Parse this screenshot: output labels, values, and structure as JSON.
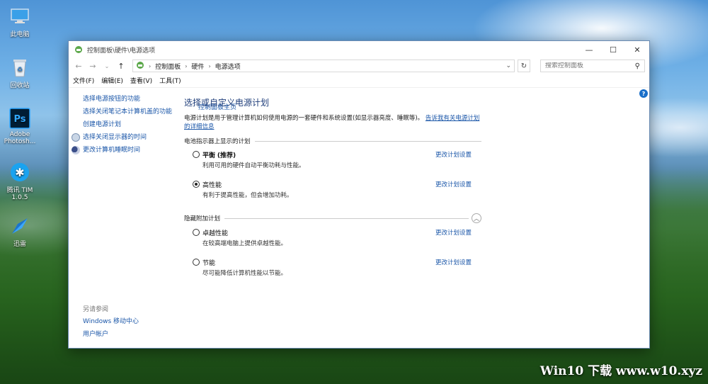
{
  "desktop": {
    "icons": [
      {
        "label": "此电脑"
      },
      {
        "label": "回收站"
      },
      {
        "label": "Adobe Photosh..."
      },
      {
        "label": "腾讯 TIM 1.0.5"
      },
      {
        "label": "迅雷"
      }
    ],
    "watermark": "Win10 下载 www.w10.xyz"
  },
  "window": {
    "title": "控制面板\\硬件\\电源选项",
    "address": {
      "crumbs": [
        "控制面板",
        "硬件",
        "电源选项"
      ]
    },
    "search": {
      "placeholder": "搜索控制面板"
    },
    "menu": [
      "文件(F)",
      "编辑(E)",
      "查看(V)",
      "工具(T)"
    ],
    "sidebar": {
      "home": "控制面板主页",
      "links": [
        "选择电源按钮的功能",
        "选择关闭笔记本计算机盖的功能",
        "创建电源计划",
        "选择关闭显示器的时间",
        "更改计算机睡眠时间"
      ],
      "see_also_title": "另请参阅",
      "see_also": [
        "Windows 移动中心",
        "用户帐户"
      ]
    },
    "main": {
      "heading": "选择或自定义电源计划",
      "description": "电源计划是用于管理计算机如何使用电源的一套硬件和系统设置(如显示器亮度、睡眠等)。",
      "description_link": "告诉我有关电源计划的详细信息",
      "section_shown": "电池指示器上显示的计划",
      "section_hidden": "隐藏附加计划",
      "change_label": "更改计划设置",
      "plans_shown": [
        {
          "name": "平衡",
          "tag": "(推荐)",
          "desc": "利用可用的硬件自动平衡功耗与性能。",
          "selected": false
        },
        {
          "name": "高性能",
          "tag": "",
          "desc": "有利于提高性能，但会增加功耗。",
          "selected": true
        }
      ],
      "plans_hidden": [
        {
          "name": "卓越性能",
          "desc": "在较高端电脑上提供卓越性能。",
          "selected": false
        },
        {
          "name": "节能",
          "desc": "尽可能降低计算机性能以节能。",
          "selected": false
        }
      ]
    }
  }
}
